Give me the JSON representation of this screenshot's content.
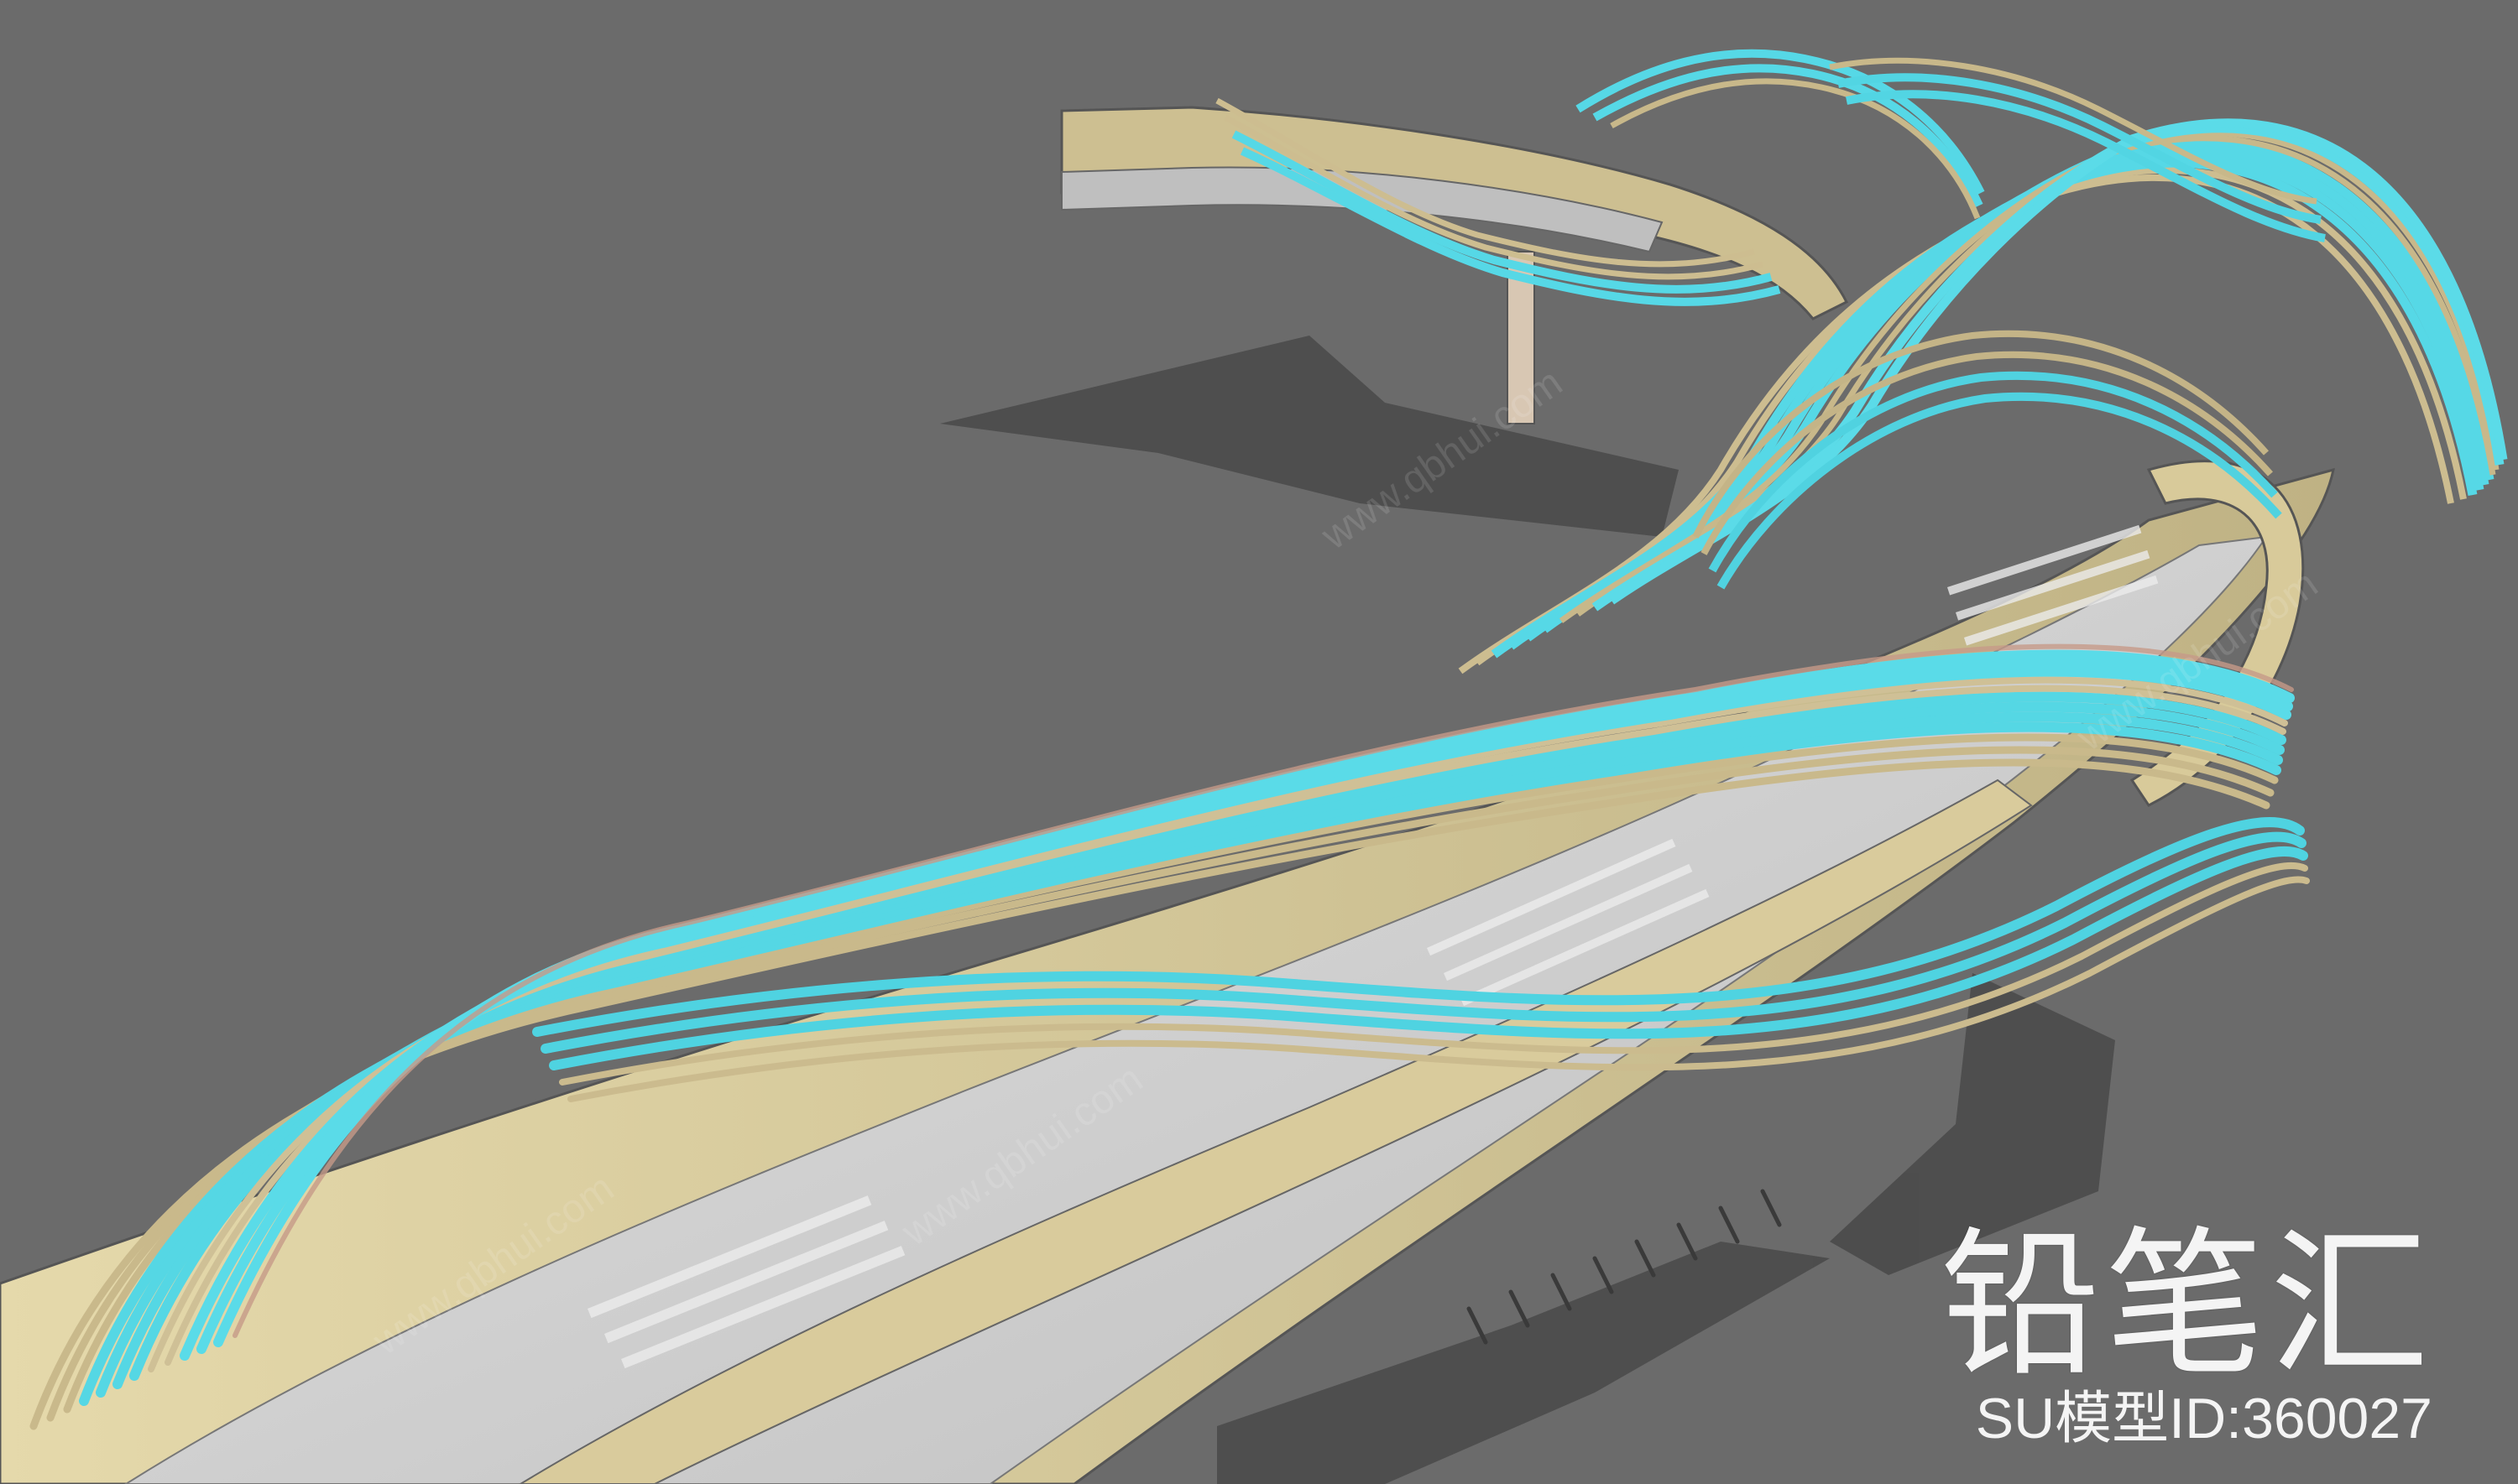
{
  "image": {
    "subject": "3D SketchUp render of a curved elevated walkway wrapped by twisting ribbon-like canopy of slats",
    "colors": {
      "background": "#6b6b6b",
      "deck": "#dacd9e",
      "deck_shadow": "#b9ad80",
      "walkway": "#cfcfcf",
      "slat_cyan": "#53d9e6",
      "slat_tan": "#cdbd90",
      "slat_pink": "#c99b8a",
      "shadow": "#3f3f3f"
    }
  },
  "watermark": {
    "brand": "铅笔汇",
    "model_id": "SU模型ID:360027",
    "tiled_text": "www.qbhui.com"
  }
}
